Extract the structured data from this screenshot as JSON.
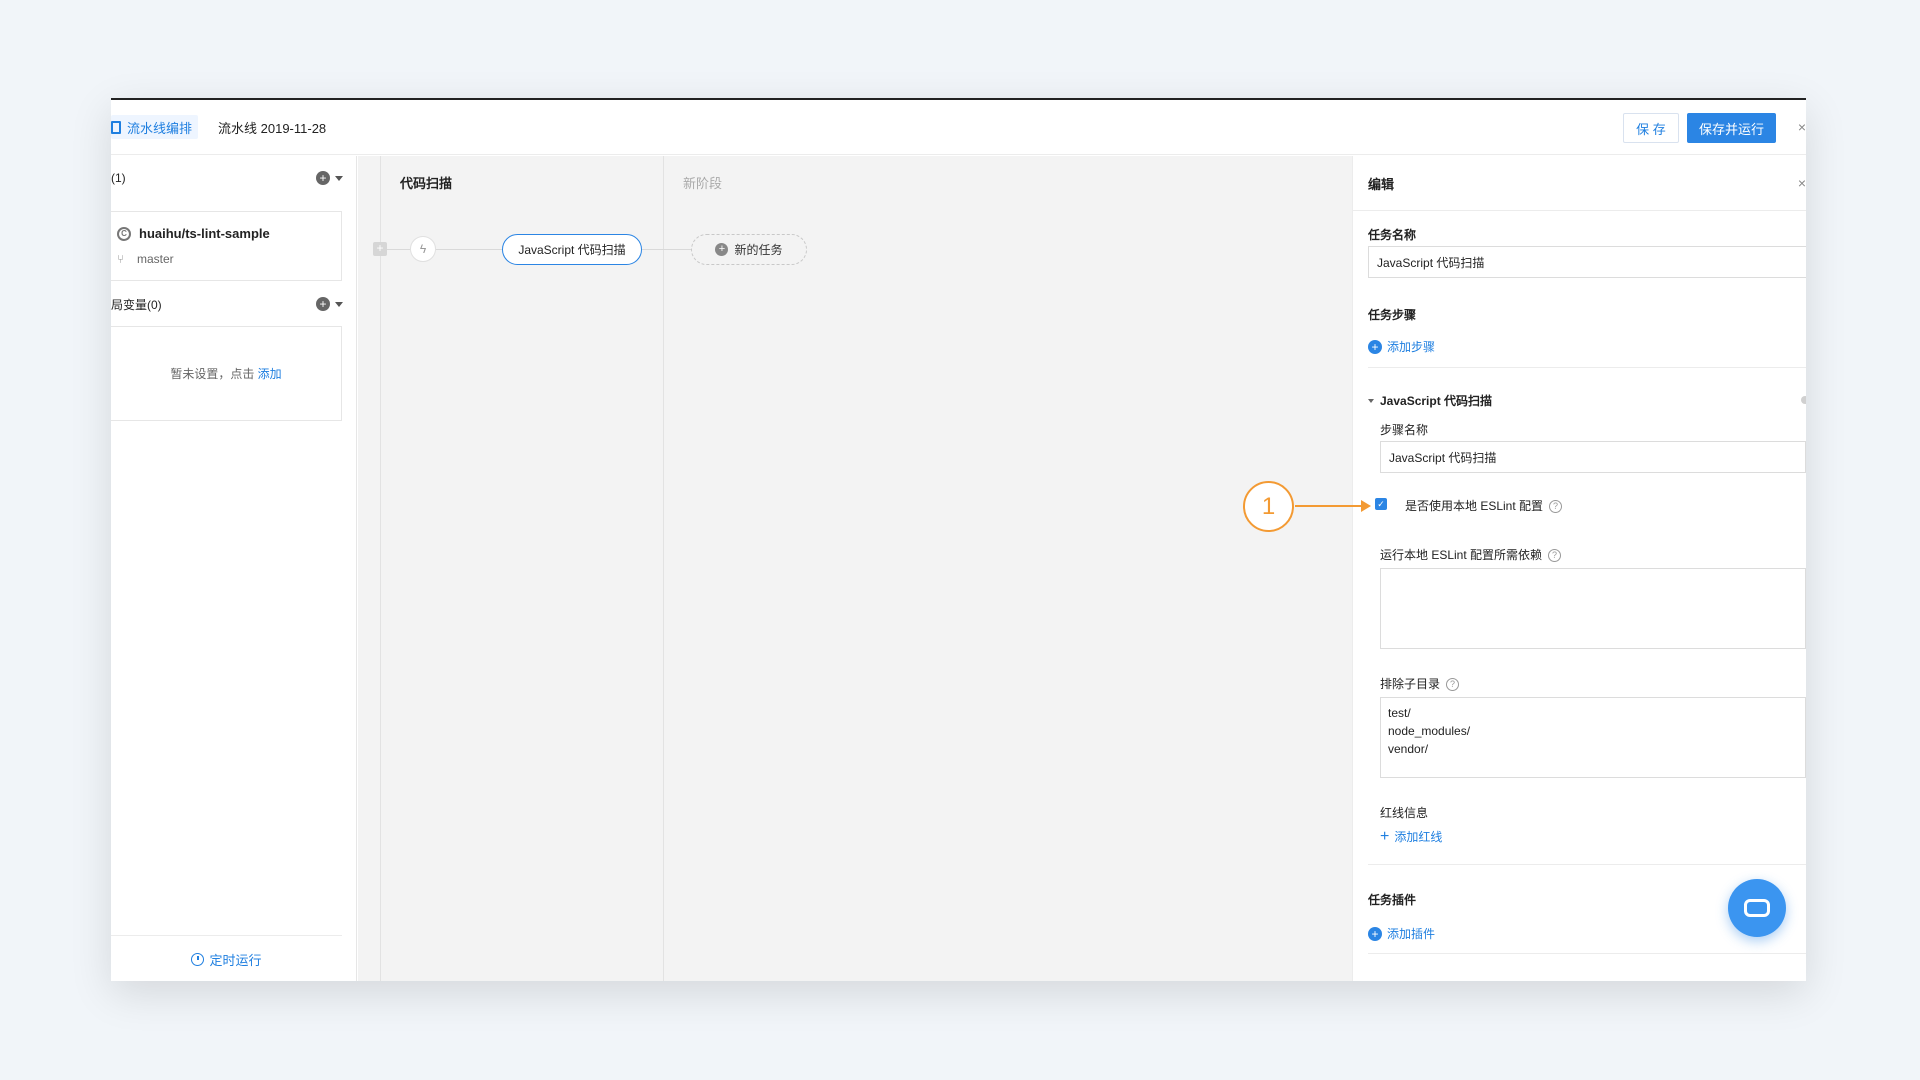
{
  "topbar": {
    "breadcrumb": "流水线编排",
    "pipeline_name": "流水线 2019-11-28",
    "save_label": "保 存",
    "save_run_label": "保存并运行",
    "close_glyph": "×"
  },
  "left_panel": {
    "source_header": "(1)",
    "repo_name": "huaihu/ts-lint-sample",
    "branch": "master",
    "vars_header": "局变量(0)",
    "vars_empty_text": "暂未设置，点击",
    "vars_add_link": "添加",
    "schedule_label": "定时运行"
  },
  "canvas": {
    "stage1_title": "代码扫描",
    "stage2_title": "新阶段",
    "task_label": "JavaScript 代码扫描",
    "new_task_label": "新的任务"
  },
  "annotation": {
    "marker": "1"
  },
  "editor": {
    "title": "编辑",
    "close_glyph": "×",
    "task_name_label": "任务名称",
    "task_name_value": "JavaScript 代码扫描",
    "task_steps_label": "任务步骤",
    "add_step_label": "添加步骤",
    "step_title": "JavaScript 代码扫描",
    "step_name_label": "步骤名称",
    "step_name_value": "JavaScript 代码扫描",
    "use_local_eslint_label": "是否使用本地 ESLint 配置",
    "use_local_eslint_checked": true,
    "deps_label": "运行本地 ESLint 配置所需依赖",
    "deps_value": "",
    "exclude_label": "排除子目录",
    "exclude_value": "test/\nnode_modules/\nvendor/",
    "redline_label": "红线信息",
    "add_redline_label": "添加红线",
    "plugins_label": "任务插件",
    "add_plugin_label": "添加插件"
  },
  "colors": {
    "accent": "#2b85e4",
    "annotation": "#f39a33"
  },
  "icons": [
    "document-icon",
    "plus-circle-icon",
    "caret-down-icon",
    "repo-icon",
    "branch-icon",
    "clock-icon",
    "lightning-icon",
    "help-icon",
    "checkbox-icon",
    "chat-icon"
  ]
}
